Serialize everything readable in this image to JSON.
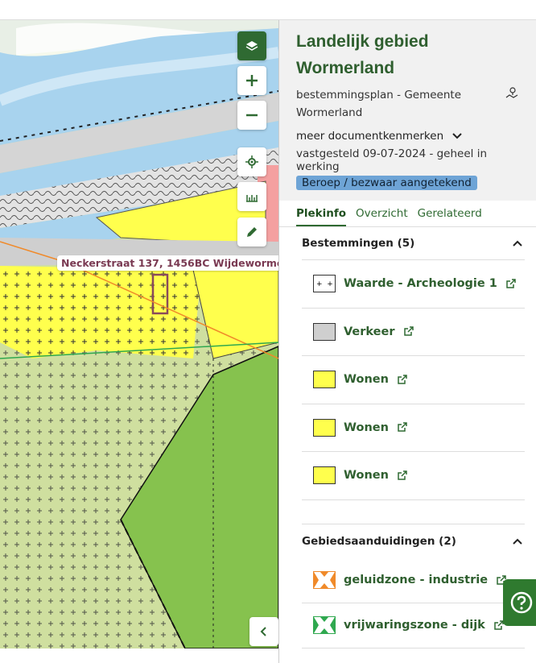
{
  "map": {
    "address_label": "Neckerstraat 137, 1456BC Wijdewormer",
    "controls": [
      "layers-icon",
      "zoom-in-icon",
      "zoom-out-icon",
      "locate-icon",
      "measure-icon",
      "draw-icon",
      "collapse-icon"
    ],
    "colors": {
      "green": "#2f6a32",
      "wonen": "#ffff4d",
      "agrarisch": "#cfdf9f",
      "water": "#a8d3ee",
      "verkeer": "#cfcfcf",
      "groen": "#86c24e"
    }
  },
  "panel": {
    "title": "Landelijk gebied Wormerland",
    "subtitle": "bestemmingsplan - Gemeente Wormerland",
    "meer": "meer documentkenmerken",
    "status": "vastgesteld 09-07-2024 - geheel in werking",
    "badge": "Beroep / bezwaar aangetekend",
    "tabs": [
      "Plekinfo",
      "Overzicht",
      "Gerelateerd"
    ],
    "bestemmingen": {
      "heading": "Bestemmingen (5)",
      "items": [
        {
          "label": "Waarde - Archeologie 1",
          "swatch": "archeologie"
        },
        {
          "label": "Verkeer",
          "swatch": "verkeer"
        },
        {
          "label": "Wonen",
          "swatch": "wonen"
        },
        {
          "label": "Wonen",
          "swatch": "wonen"
        },
        {
          "label": "Wonen",
          "swatch": "wonen"
        }
      ]
    },
    "gebiedsaanduidingen": {
      "heading": "Gebiedsaanduidingen (2)",
      "items": [
        {
          "label": "geluidzone - industrie",
          "swatch": "geluidzone"
        },
        {
          "label": "vrijwaringszone - dijk",
          "swatch": "vrijwaringszone"
        }
      ]
    }
  },
  "help": {
    "icon": "help-icon"
  }
}
